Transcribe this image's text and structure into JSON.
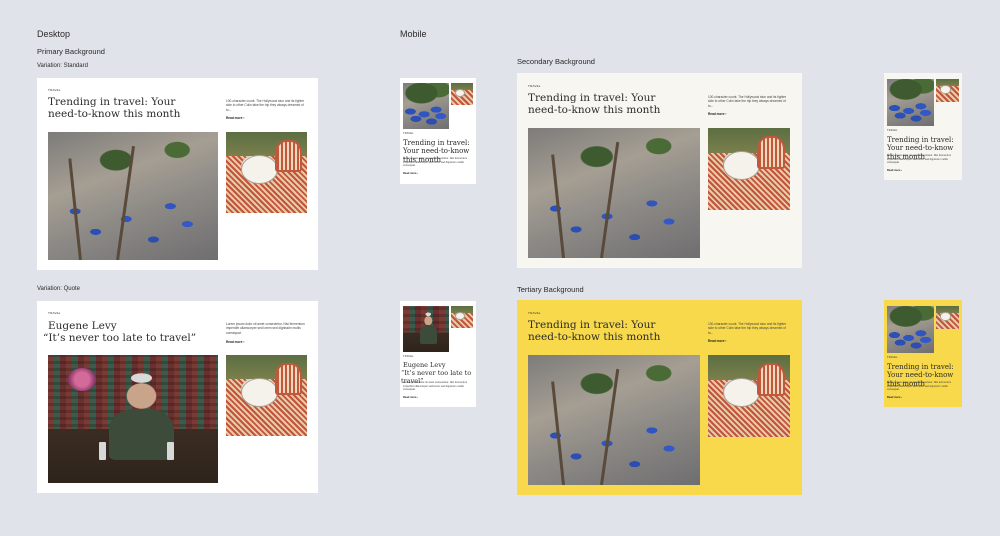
{
  "labels": {
    "desktop": "Desktop",
    "mobile": "Mobile",
    "primary_background": "Primary Background",
    "secondary_background": "Secondary Background",
    "tertiary_background": "Tertiary Background",
    "variation_standard": "Variation: Standard",
    "variation_quote": "Variation: Quote"
  },
  "standard": {
    "eyebrow": "TRAVEL",
    "heading": "Trending in travel: Your need-to-know this month",
    "mobile_heading": "Trending in travel: Your need-to-know this month",
    "body": "100-character count. The Hollywood stun and its fighter side to other Colin take the trip they always dreamed of to...",
    "mobile_body": "Lorem ipsum dolor sit amet consectetur. Nisi fermentum imperdiet ullamcorper sed lorem sed dignissim mollis consequat.",
    "read_more": "Read more  ›"
  },
  "quote": {
    "eyebrow": "TRAVEL",
    "heading_line1": "Eugene Levy",
    "heading_line2": "“It’s never too late to travel”",
    "body": "Lorem ipsum dolor sit amet consectetur. Nisi fermentum imperdiet ullamcorper sed lorem sed dignissim mollis consequat.",
    "read_more": "Read more  ›"
  },
  "images": {
    "palm": "beach-palms-umbrellas-image",
    "cafe": "cafe-table-chairs-image",
    "portrait": "eugene-levy-portrait-image"
  },
  "colors": {
    "canvas": "#e1e3ea",
    "primary": "#ffffff",
    "secondary": "#f8f6f1",
    "tertiary": "#f7d94b"
  }
}
